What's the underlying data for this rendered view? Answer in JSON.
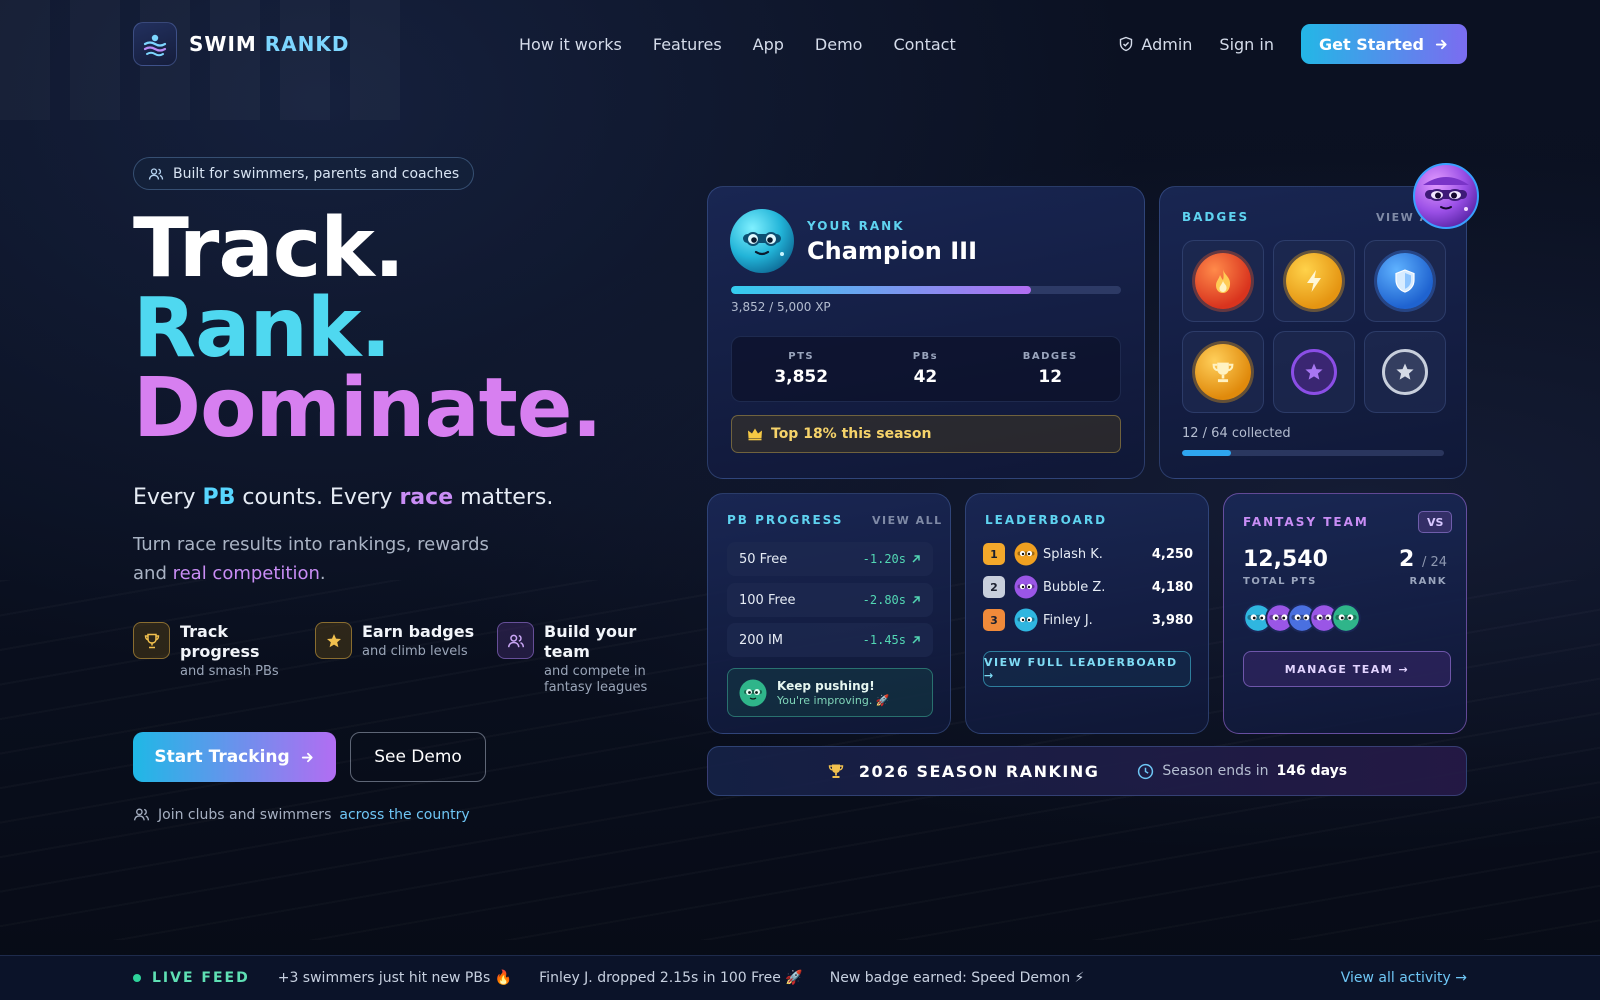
{
  "colors": {
    "accent_cyan": "#4fd8f0",
    "accent_purple": "#d77ff0",
    "card_bg": "#1a2856",
    "success": "#52d7b4",
    "gold": "#f6d36a"
  },
  "nav": {
    "brand_first": "SWIM",
    "brand_second": "RANKD",
    "links": [
      "How it works",
      "Features",
      "App",
      "Demo",
      "Contact"
    ],
    "admin": "Admin",
    "sign_in": "Sign in",
    "cta": "Get Started"
  },
  "hero": {
    "pill": "Built for swimmers, parents and coaches",
    "line1": "Track.",
    "line2": "Rank.",
    "line3": "Dominate.",
    "tagline": {
      "p1": "Every ",
      "pb": "PB",
      "p2": " counts. Every ",
      "race": "race",
      "p3": " matters."
    },
    "sub": {
      "p1": "Turn race results into rankings, rewards and ",
      "highlight": "real competition",
      "p2": "."
    },
    "features": [
      {
        "icon": "trophy-icon",
        "title": "Track progress",
        "sub": "and smash PBs"
      },
      {
        "icon": "star-icon",
        "title": "Earn badges",
        "sub": "and climb levels"
      },
      {
        "icon": "team-icon",
        "title": "Build your team",
        "sub": "and compete in fantasy leagues"
      }
    ],
    "start_btn": "Start Tracking",
    "demo_btn": "See Demo",
    "join_text": "Join clubs and swimmers",
    "join_link": "across the country"
  },
  "rank_card": {
    "label": "YOUR RANK",
    "title": "Champion III",
    "xp_current": 3852,
    "xp_max": 5000,
    "xp_text": "3,852 / 5,000 XP",
    "stats": [
      {
        "label": "PTS",
        "value": "3,852"
      },
      {
        "label": "PBs",
        "value": "42"
      },
      {
        "label": "BADGES",
        "value": "12"
      }
    ],
    "top_badge": "Top 18% this season"
  },
  "badges_card": {
    "label": "BADGES",
    "view_all": "VIEW ALL",
    "badges": [
      {
        "icon": "fire-icon",
        "color": "#e2462a"
      },
      {
        "icon": "lightning-icon",
        "color": "#f0a81a"
      },
      {
        "icon": "shield-icon",
        "color": "#2f7fe8"
      },
      {
        "icon": "trophy-icon",
        "color": "#f2a10f"
      },
      {
        "icon": "star-icon",
        "color": "#7a3fd6"
      },
      {
        "icon": "star-icon",
        "color": "#c8cfdc"
      }
    ],
    "collected_text": "12 / 64 collected",
    "collected": 12,
    "total": 64
  },
  "pb_card": {
    "label": "PB PROGRESS",
    "view_all": "VIEW ALL",
    "rows": [
      {
        "event": "50 Free",
        "delta": "-1.20s"
      },
      {
        "event": "100 Free",
        "delta": "-2.80s"
      },
      {
        "event": "200 IM",
        "delta": "-1.45s"
      }
    ],
    "msg_title": "Keep pushing!",
    "msg_sub": "You're improving. 🚀"
  },
  "leaderboard": {
    "label": "LEADERBOARD",
    "rows": [
      {
        "rank": "1",
        "name": "Splash K.",
        "score": "4,250",
        "rank_color": "#f3a82b",
        "avatar_color": "#f0a020"
      },
      {
        "rank": "2",
        "name": "Bubble Z.",
        "score": "4,180",
        "rank_color": "#c8cfdc",
        "avatar_color": "#9a56e6"
      },
      {
        "rank": "3",
        "name": "Finley J.",
        "score": "3,980",
        "rank_color": "#f08a3a",
        "avatar_color": "#2fb6e0"
      }
    ],
    "button": "VIEW FULL LEADERBOARD →"
  },
  "fantasy": {
    "label": "FANTASY TEAM",
    "vs": "VS",
    "total_pts": "12,540",
    "total_pts_label": "TOTAL PTS",
    "rank": "2",
    "rank_of": "/ 24",
    "rank_label": "RANK",
    "team_colors": [
      "#2fb6e0",
      "#9a56e6",
      "#4a70e0",
      "#9a56e6",
      "#2fb58a"
    ],
    "button": "MANAGE TEAM →"
  },
  "season": {
    "title": "2026 SEASON RANKING",
    "ends_text": "Season ends in",
    "days": "146 days"
  },
  "live_feed": {
    "label": "LIVE FEED",
    "items": [
      "+3 swimmers just hit new PBs 🔥",
      "Finley J. dropped 2.15s in 100 Free 🚀",
      "New badge earned: Speed Demon ⚡"
    ],
    "view_all": "View all activity →"
  }
}
